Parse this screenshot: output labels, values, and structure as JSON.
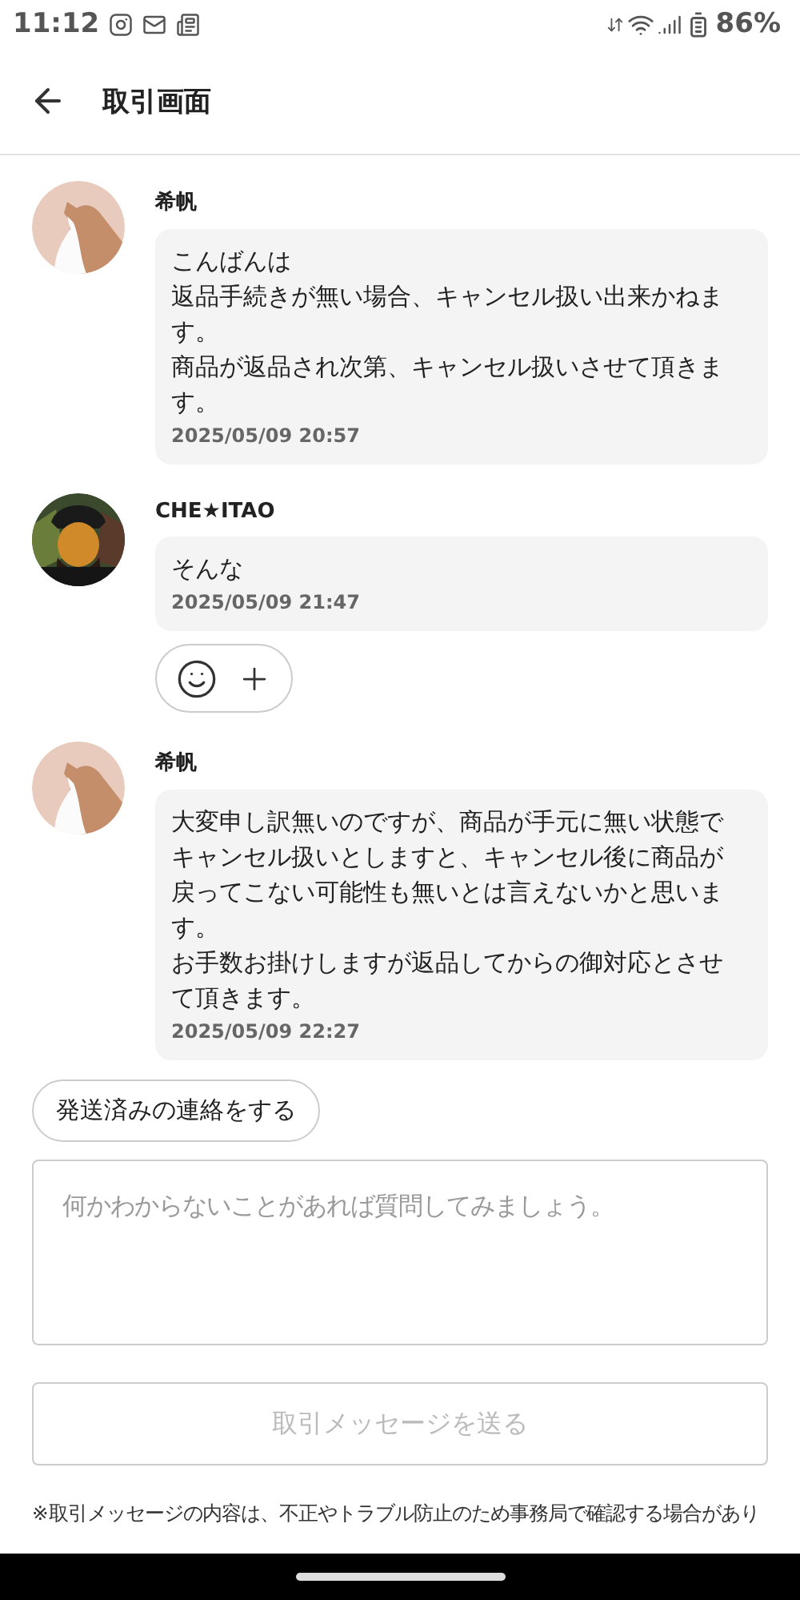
{
  "status_bar": {
    "time": "11:12",
    "battery": "86%"
  },
  "header": {
    "title": "取引画面"
  },
  "messages": [
    {
      "sender": "希帆",
      "avatar": {
        "kind": "cat"
      },
      "paragraphs": [
        "こんばんは",
        "返品手続きが無い場合、キャンセル扱い出来かねます。",
        "商品が返品され次第、キャンセル扱いさせて頂きます。"
      ],
      "time": "2025/05/09 20:57",
      "reactions": false
    },
    {
      "sender": "CHE★ITAO",
      "avatar": {
        "kind": "picture"
      },
      "paragraphs": [
        "そんな"
      ],
      "time": "2025/05/09 21:47",
      "reactions": true
    },
    {
      "sender": "希帆",
      "avatar": {
        "kind": "cat"
      },
      "paragraphs": [
        "大変申し訳無いのですが、商品が手元に無い状態でキャンセル扱いとしますと、キャンセル後に商品が戻ってこない可能性も無いとは言えないかと思います。",
        "お手数お掛けしますが返品してからの御対応とさせて頂きます。"
      ],
      "time": "2025/05/09 22:27",
      "reactions": false
    }
  ],
  "shipped_button": "発送済みの連絡をする",
  "message_field": {
    "placeholder": "何かわからないことがあれば質問してみましょう。"
  },
  "send_button": {
    "label": "取引メッセージを送る",
    "disabled": true
  },
  "note": "※取引メッセージの内容は、不正やトラブル防止のため事務局で確認する場合があり"
}
